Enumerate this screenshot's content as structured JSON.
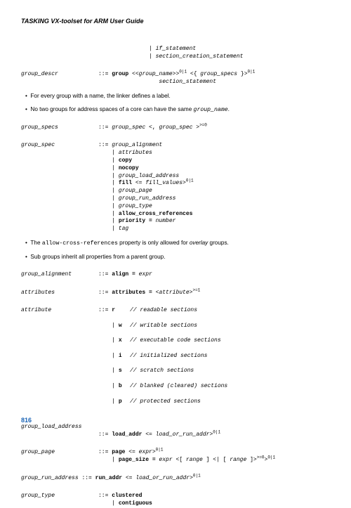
{
  "header": {
    "title": "TASKING VX-toolset for ARM User Guide"
  },
  "block0": {
    "l1": "| if_statement",
    "l2": "| section_creation_statement"
  },
  "block1": {
    "lhs": "group_descr",
    "sep": "::=",
    "rhs_a": "group",
    "rhs_b": "<group_name>",
    "rhs_c": "0|1",
    "rhs_d": " <{ ",
    "rhs_e": "group_specs",
    "rhs_f": " }>",
    "rhs_g": "0|1",
    "l2": "section_statement"
  },
  "bullets": {
    "b1": "For every group with a name, the linker defines a label.",
    "b2_a": "No two groups for address spaces of a core can have the same ",
    "b2_b": "group_name",
    "b2_c": ".",
    "b3_a": "The ",
    "b3_b": "allow-cross-references",
    "b3_c": " property is only allowed for ",
    "b3_d": "overlay",
    "b3_e": " groups.",
    "b4": "Sub groups inherit all properties from a parent group."
  },
  "block2": {
    "lhs": "group_specs",
    "sep": "::=",
    "a": "group_spec",
    "b": " <, ",
    "c": "group_spec",
    "d": " >",
    "e": ">=0"
  },
  "block3": {
    "lhs": "group_spec",
    "sep": "::=",
    "l1": "group_alignment",
    "l2": "| attributes",
    "l3": "| copy",
    "l4": "| nocopy",
    "l5": "| group_load_address",
    "l6a": "| ",
    "l6b": "fill",
    "l6c": " <= ",
    "l6d": "fill_values",
    "l6e": ">",
    "l6f": "0|1",
    "l7": "| group_page",
    "l8": "| group_run_address",
    "l9": "| group_type",
    "l10": "| allow_cross_references",
    "l11a": "| ",
    "l11b": "priority =",
    "l11c": " number",
    "l12": "| tag"
  },
  "block4": {
    "lhs": "group_alignment",
    "sep": "::=",
    "a": "align =",
    "b": " expr"
  },
  "block5": {
    "lhs": "attributes",
    "sep": "::=",
    "a": "attributes =",
    "b": " <",
    "c": "attribute",
    "d": ">",
    "e": ">=1"
  },
  "block6": {
    "lhs": "attribute",
    "sep": "::=",
    "r1a": "r",
    "r1b": "// readable sections",
    "r2a": "| w",
    "r2b": "// writable sections",
    "r3a": "| x",
    "r3b": "// executable code sections",
    "r4a": "| i",
    "r4b": "// initialized sections",
    "r5a": "| s",
    "r5b": "// scratch sections",
    "r6a": "| b",
    "r6b": "// blanked (cleared) sections",
    "r7a": "| p",
    "r7b": "// protected sections"
  },
  "block7": {
    "lhs": "group_load_address",
    "sep": "::=",
    "a": "load_addr",
    "b": " <= ",
    "c": "load_or_run_addr",
    "d": ">",
    "e": "0|1"
  },
  "block8": {
    "lhs": "group_page",
    "sep": "::=",
    "l1a": "page",
    "l1b": " <= ",
    "l1c": "expr",
    "l1d": ">",
    "l1e": "0|1",
    "l2a": "| ",
    "l2b": "page_size =",
    "l2c": " expr",
    "l2d": " <[ ",
    "l2e": "range",
    "l2f": " ] <| [ ",
    "l2g": "range",
    "l2h": " ]>",
    "l2i": ">=0",
    "l2j": ">",
    "l2k": "0|1"
  },
  "block9": {
    "lhs": "group_run_address",
    "sep": "::=",
    "a": "run_addr",
    "b": " <= ",
    "c": "load_or_run_addr",
    "d": ">",
    "e": "0|1"
  },
  "block10": {
    "lhs": "group_type",
    "sep": "::=",
    "l1": "clustered",
    "l2": "| contiguous"
  },
  "page_number": "816"
}
